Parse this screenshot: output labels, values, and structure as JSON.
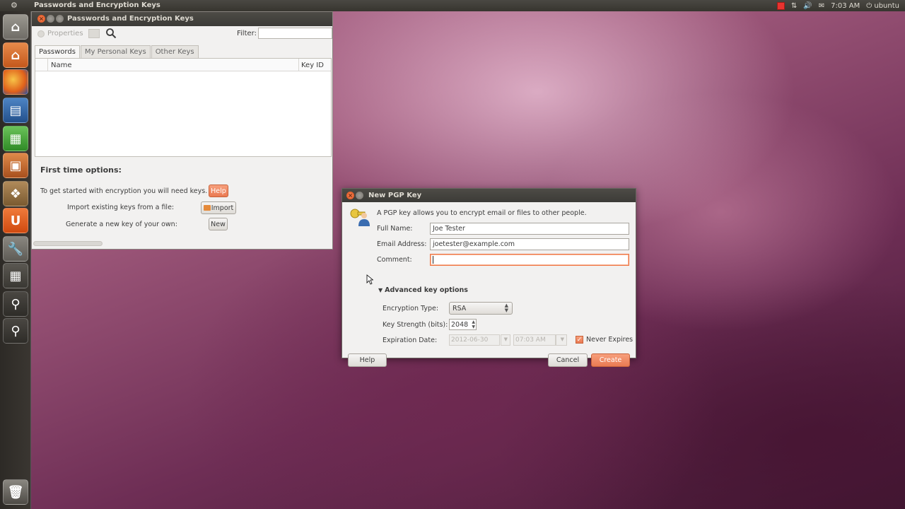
{
  "top_panel": {
    "app_title": "Passwords and Encryption Keys",
    "time": "7:03 AM",
    "user": "ubuntu"
  },
  "launcher": {
    "items": [
      "dash-home",
      "files",
      "firefox",
      "libreoffice-writer",
      "libreoffice-calc",
      "libreoffice-impress",
      "software-center",
      "ubuntu-one",
      "system-settings",
      "workspace-switcher",
      "seahorse-search",
      "dash-lens",
      "trash"
    ]
  },
  "main_window": {
    "title": "Passwords and Encryption Keys",
    "toolbar": {
      "properties_label": "Properties",
      "filter_label": "Filter:",
      "filter_value": ""
    },
    "tabs": [
      {
        "label": "Passwords",
        "active": true
      },
      {
        "label": "My Personal Keys",
        "active": false
      },
      {
        "label": "Other Keys",
        "active": false
      }
    ],
    "columns": {
      "name": "Name",
      "key_id": "Key ID"
    },
    "first_time": {
      "title": "First time options:",
      "row1_text": "To get started with encryption you will need keys.",
      "row1_button": "Help",
      "row2_text": "Import existing keys from a file:",
      "row2_button": "Import",
      "row3_text": "Generate a new key of your own:",
      "row3_button": "New"
    }
  },
  "dialog": {
    "title": "New PGP Key",
    "description": "A PGP key allows you to encrypt email or files to other people.",
    "full_name_label": "Full Name:",
    "full_name_value": "Joe Tester",
    "email_label": "Email Address:",
    "email_value": "joetester@example.com",
    "comment_label": "Comment:",
    "comment_value": "",
    "advanced_label": "Advanced key options",
    "encryption_type_label": "Encryption Type:",
    "encryption_type_value": "RSA",
    "key_strength_label": "Key Strength (bits):",
    "key_strength_value": "2048",
    "expiration_label": "Expiration Date:",
    "expiration_date_value": "2012-06-30",
    "expiration_time_value": "07:03 AM",
    "never_expires_label": "Never Expires",
    "never_expires_checked": true,
    "help_button": "Help",
    "cancel_button": "Cancel",
    "create_button": "Create"
  },
  "colors": {
    "accent": "#ea7a52",
    "panel": "#3c3b37",
    "window_bg": "#f2f1f0"
  }
}
